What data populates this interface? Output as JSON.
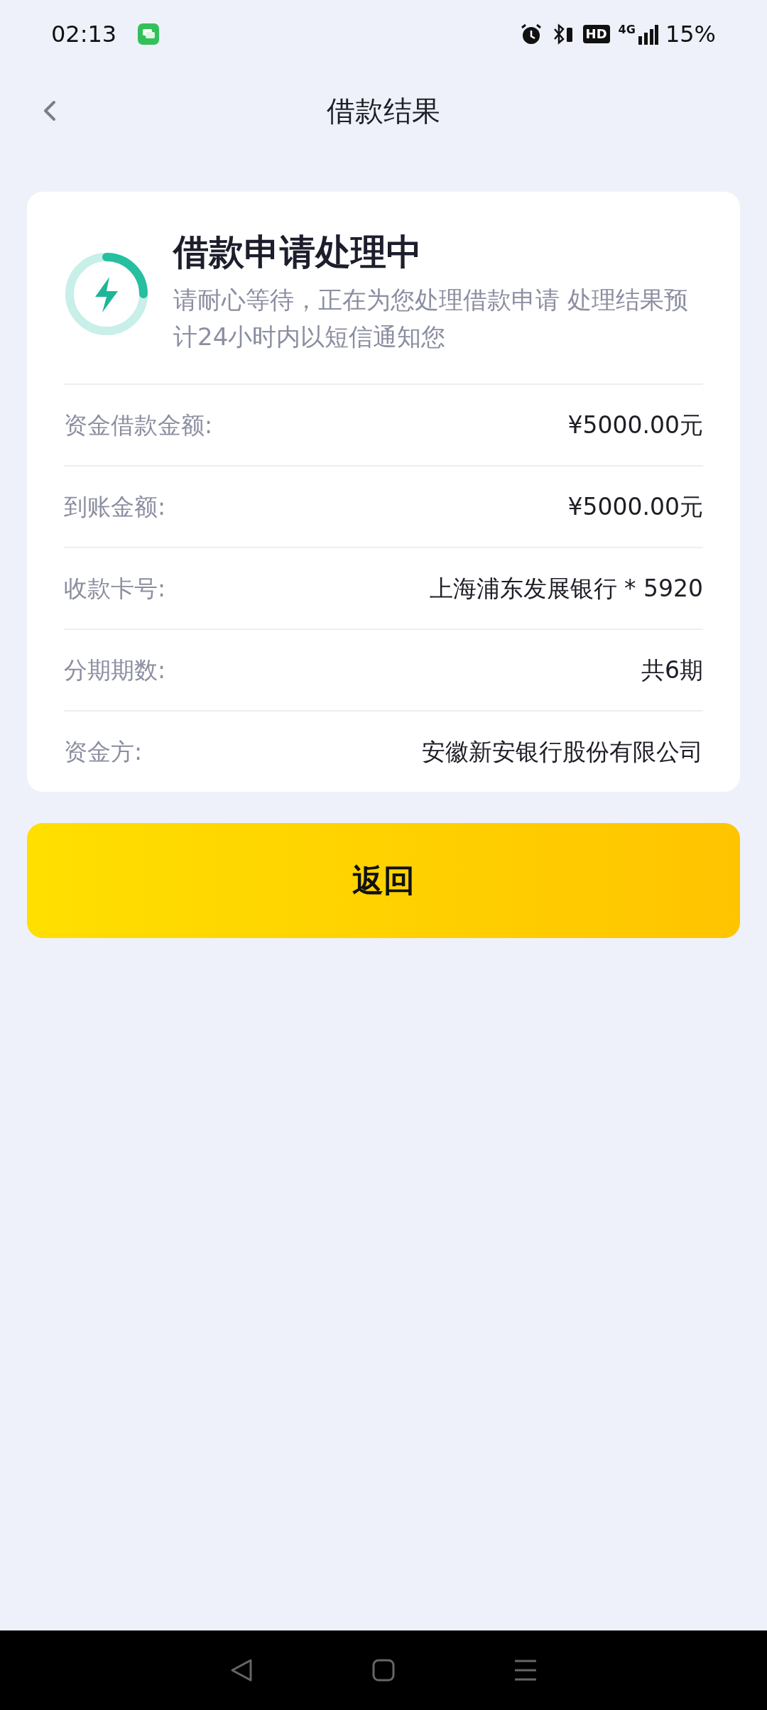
{
  "status_bar": {
    "time": "02:13",
    "hd": "HD",
    "network": "4G",
    "battery": "15%"
  },
  "header": {
    "title": "借款结果"
  },
  "result": {
    "title": "借款申请处理中",
    "message": "请耐心等待，正在为您处理借款申请 处理结果预计24小时内以短信通知您"
  },
  "details": [
    {
      "label": "资金借款金额:",
      "value": "¥5000.00元"
    },
    {
      "label": "到账金额:",
      "value": "¥5000.00元"
    },
    {
      "label": "收款卡号:",
      "value": "上海浦东发展银行 * 5920"
    },
    {
      "label": "分期期数:",
      "value": "共6期"
    },
    {
      "label": "资金方:",
      "value": "安徽新安银行股份有限公司"
    }
  ],
  "button": {
    "label": "返回"
  }
}
